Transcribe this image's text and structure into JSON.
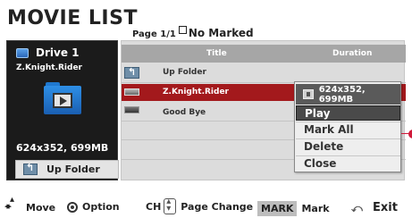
{
  "header": {
    "title": "MOVIE LIST",
    "page_label": "Page 1/1",
    "marked_label": "No Marked"
  },
  "device_panel": {
    "drive_name": "Drive 1",
    "selected_file": "Z.Knight.Rider",
    "resolution_size": "624x352,  699MB",
    "up_folder_button": "Up Folder"
  },
  "file_list": {
    "columns": [
      "Title",
      "Duration"
    ],
    "rows": [
      {
        "title": "Up Folder",
        "duration": "",
        "selected": false
      },
      {
        "title": "Z.Knight.Rider",
        "duration": "",
        "selected": true
      },
      {
        "title": "Good Bye",
        "duration": "",
        "selected": false
      }
    ]
  },
  "popup_menu": {
    "info": "624x352,  699MB",
    "items": [
      "Play",
      "Mark All",
      "Delete",
      "Close"
    ],
    "active_item": "Play"
  },
  "footer": {
    "move": "Move",
    "option": "Option",
    "ch_label": "CH",
    "page_change": "Page Change",
    "mark_key": "MARK",
    "mark": "Mark",
    "exit": "Exit"
  },
  "colors": {
    "selected_row": "#a3191c",
    "panel_bg": "#1b1b1b",
    "list_bg": "#dcdcdc",
    "header_bar": "#a6a6a6",
    "pointer": "#d01a3a"
  },
  "icons": [
    "drive-icon",
    "folder-play-icon",
    "up-folder-icon",
    "movie-file-icon",
    "info-icon",
    "move-arrows-icon",
    "option-circle-icon",
    "channel-updown-icon",
    "exit-icon"
  ]
}
